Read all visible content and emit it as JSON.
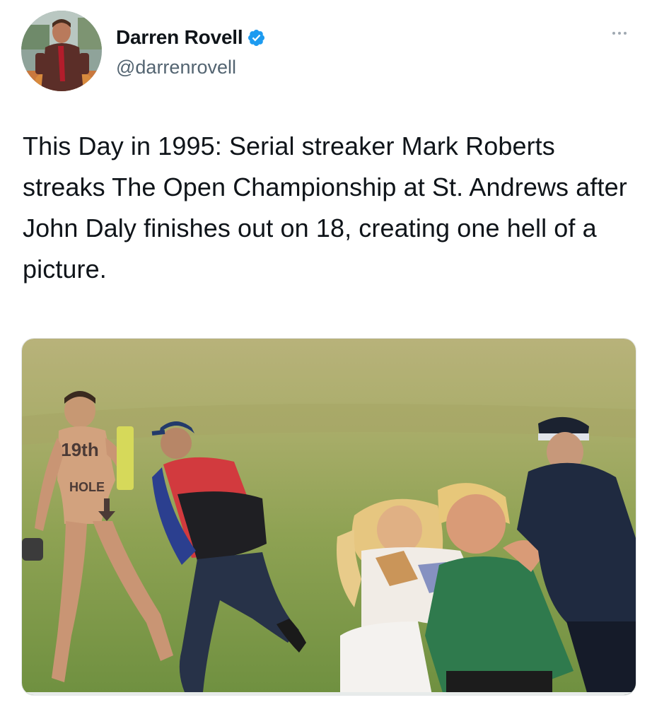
{
  "tweet": {
    "author": {
      "display_name": "Darren Rovell",
      "handle": "@darrenrovell",
      "verified": true,
      "verified_icon": "verified-badge-icon"
    },
    "more_icon": "more-options-icon",
    "text": "This Day in 1995: Serial streaker Mark Roberts streaks The Open Championship at St. Andrews after John Daly finishes out on 18, creating one hell of a picture.",
    "media": {
      "type": "photo",
      "body_writing": [
        "19th",
        "HOLE"
      ]
    }
  },
  "colors": {
    "verified_blue": "#1d9bf0",
    "handle_gray": "#536471",
    "text": "#0f1419"
  }
}
